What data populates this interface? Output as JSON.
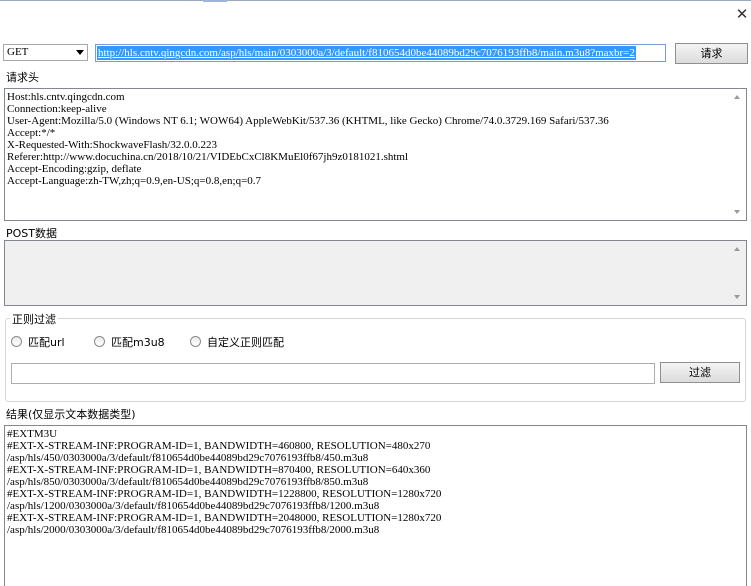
{
  "window": {
    "close_label": "✕"
  },
  "request": {
    "method": "GET",
    "url": "http://hls.cntv.qingcdn.com/asp/hls/main/0303000a/3/default/f810654d0be44089bd29c7076193ffb8/main.m3u8?maxbr=2",
    "send_label": "请求"
  },
  "headers": {
    "label": "请求头",
    "text": "Host:hls.cntv.qingcdn.com\nConnection:keep-alive\nUser-Agent:Mozilla/5.0 (Windows NT 6.1; WOW64) AppleWebKit/537.36 (KHTML, like Gecko) Chrome/74.0.3729.169 Safari/537.36\nAccept:*/*\nX-Requested-With:ShockwaveFlash/32.0.0.223\nReferer:http://www.docuchina.cn/2018/10/21/VIDEbCxCl8KMuEl0f67jh9z0181021.shtml\nAccept-Encoding:gzip, deflate\nAccept-Language:zh-TW,zh;q=0.9,en-US;q=0.8,en;q=0.7"
  },
  "post": {
    "label": "POST数据",
    "text": ""
  },
  "regex_filter": {
    "title": "正则过滤",
    "options": [
      "匹配url",
      "匹配m3u8",
      "自定义正则匹配"
    ],
    "pattern": "",
    "filter_label": "过滤"
  },
  "result": {
    "label": "结果(仅显示文本数据类型)",
    "text": "#EXTM3U\n#EXT-X-STREAM-INF:PROGRAM-ID=1, BANDWIDTH=460800, RESOLUTION=480x270\n/asp/hls/450/0303000a/3/default/f810654d0be44089bd29c7076193ffb8/450.m3u8\n#EXT-X-STREAM-INF:PROGRAM-ID=1, BANDWIDTH=870400, RESOLUTION=640x360\n/asp/hls/850/0303000a/3/default/f810654d0be44089bd29c7076193ffb8/850.m3u8\n#EXT-X-STREAM-INF:PROGRAM-ID=1, BANDWIDTH=1228800, RESOLUTION=1280x720\n/asp/hls/1200/0303000a/3/default/f810654d0be44089bd29c7076193ffb8/1200.m3u8\n#EXT-X-STREAM-INF:PROGRAM-ID=1, BANDWIDTH=2048000, RESOLUTION=1280x720\n/asp/hls/2000/0303000a/3/default/f810654d0be44089bd29c7076193ffb8/2000.m3u8"
  }
}
